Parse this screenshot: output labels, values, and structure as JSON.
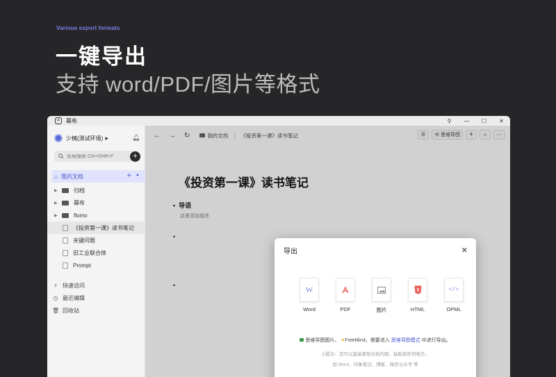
{
  "hero": {
    "tag": "Various export formats",
    "title": "一键导出",
    "subtitle": "支持 word/PDF/图片等格式"
  },
  "window": {
    "app_name": "幕布",
    "controls": [
      "pin-icon",
      "minimize-icon",
      "maximize-icon",
      "close-icon"
    ]
  },
  "sidebar": {
    "workspace": "少楠(测试环境)",
    "search_placeholder": "全局搜索 Ctrl+Shift+F",
    "my_docs": "我的文档",
    "tree": [
      {
        "name": "归档",
        "type": "folder"
      },
      {
        "name": "幕布",
        "type": "folder"
      },
      {
        "name": "flomo",
        "type": "folder"
      },
      {
        "name": "《投资第一课》读书笔记",
        "type": "doc",
        "active": true
      },
      {
        "name": "关键问题",
        "type": "doc"
      },
      {
        "name": "旧工业联合体",
        "type": "doc"
      },
      {
        "name": "Prompt",
        "type": "doc"
      }
    ],
    "bottom": [
      {
        "name": "快速访问",
        "icon": "lightning-icon"
      },
      {
        "name": "最近编辑",
        "icon": "clock-icon"
      },
      {
        "name": "回收站",
        "icon": "trash-icon"
      }
    ]
  },
  "toolbar": {
    "breadcrumb_root": "我的文档",
    "breadcrumb_current": "《投资第一课》读书笔记",
    "mindmap_label": "思维导图"
  },
  "document": {
    "title": "《投资第一课》读书笔记",
    "bullet1": "导语",
    "description": "这里添加描述"
  },
  "modal": {
    "title": "导出",
    "formats": [
      {
        "label": "Word",
        "icon": "word-icon",
        "color": "#7b86e0"
      },
      {
        "label": "PDF",
        "icon": "pdf-icon",
        "color": "#e8615a"
      },
      {
        "label": "图片",
        "icon": "image-icon",
        "color": "#8a8a8a"
      },
      {
        "label": "HTML",
        "icon": "html5-icon",
        "color": "#e8615a"
      },
      {
        "label": "OPML",
        "icon": "opml-icon",
        "color": "#7b86e0"
      }
    ],
    "note_part1": "思维导图图片、",
    "note_part2": "FreeMind，需要进入",
    "note_link": "思维导图模式",
    "note_part3": "中进行导出。",
    "tip_line1": "小提示：您可以直接复制文档内容，粘贴到任何地方，",
    "tip_line2": "如 Word、印象笔记、博客、微信公众号 等"
  }
}
